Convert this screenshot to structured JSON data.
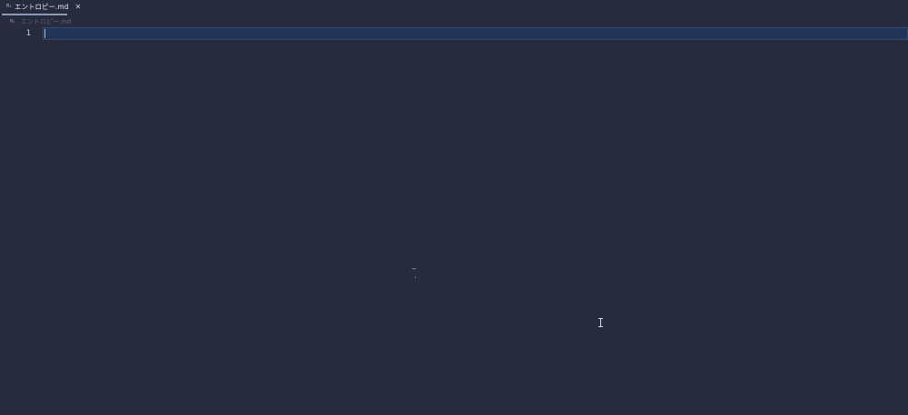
{
  "tabs": [
    {
      "icon": "M↓",
      "label": "エントロピー.md",
      "close": "✕"
    }
  ],
  "breadcrumb": {
    "icon": "M↓",
    "label": "エントロピー.md"
  },
  "editor": {
    "line_numbers": [
      "1"
    ],
    "current_line_highlight": "#233556"
  },
  "colors": {
    "background": "#282b3c",
    "accent": "#8a9bb8",
    "markdown_icon": "#5ba0e0"
  },
  "icons": {
    "tab_icon": "markdown-icon",
    "close": "close-icon",
    "mouse_pointer": "text-cursor-icon"
  }
}
